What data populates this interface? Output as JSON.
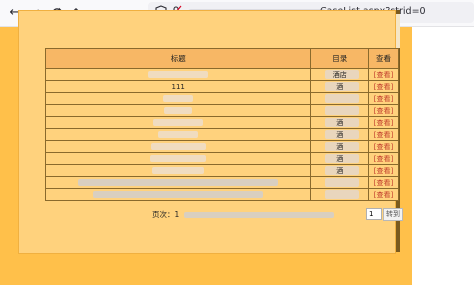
{
  "browser": {
    "back_icon": "arrow-left-icon",
    "forward_icon": "arrow-right-icon",
    "reload_icon": "reload-icon",
    "home_icon": "home-icon",
    "url_suffix": "CaseList.aspx?strid=0"
  },
  "table": {
    "headers": [
      "标题",
      "目录",
      "查看"
    ],
    "rows": [
      {
        "title": "",
        "category": "酒店",
        "view": "[查看]"
      },
      {
        "title": "111",
        "category": "酒",
        "view": "[查看]"
      },
      {
        "title": "",
        "category": "",
        "view": "[查看]"
      },
      {
        "title": "",
        "category": "",
        "view": "[查看]"
      },
      {
        "title": "",
        "category": "酒",
        "view": "[查看]"
      },
      {
        "title": "",
        "category": "酒",
        "view": "[查看]"
      },
      {
        "title": "",
        "category": "酒",
        "view": "[查看]"
      },
      {
        "title": "",
        "category": "酒",
        "view": "[查看]"
      },
      {
        "title": "",
        "category": "酒",
        "view": "[查看]"
      },
      {
        "title": "",
        "category": "",
        "view": "[查看]"
      },
      {
        "title": "",
        "category": "",
        "view": "[查看]"
      }
    ]
  },
  "pager": {
    "label": "页次：1",
    "page_input": "1",
    "go_label": "转到"
  },
  "colors": {
    "page_background": "#ffc04a",
    "panel_background": "#ffd27d",
    "header_background": "#f7b765",
    "link_color": "#c0392b"
  }
}
